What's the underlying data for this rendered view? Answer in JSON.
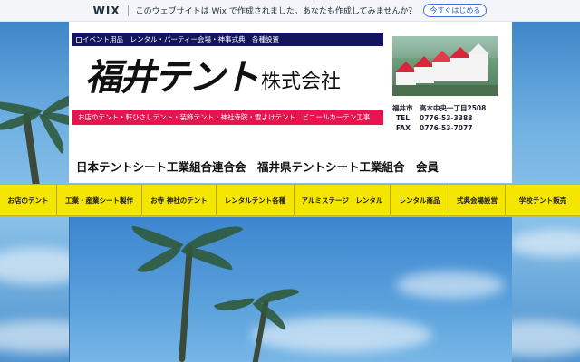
{
  "wix_bar": {
    "logo": "WIX",
    "message": "このウェブサイトは Wix で作成されました。あなたも作成してみませんか？",
    "cta": "今すぐはじめる"
  },
  "header": {
    "top_bar_text": "イベント用品　レンタル・パーティー会場・神事式典　各種設置",
    "logo_main": "福井テント",
    "logo_sub": "株式会社",
    "services_bar": "お店のテント・軒ひさしテント・装飾テント・神社寺院・雪よけテント　ビニールカーテン工事",
    "contact": {
      "address_label": "福井市",
      "address": "高木中央一丁目2508",
      "tel_label": "TEL",
      "tel": "0776-53-3388",
      "fax_label": "FAX",
      "fax": "0776-53-7077"
    },
    "union_text": "日本テントシート工業組合連合会　福井県テントシート工業組合　会員"
  },
  "nav": {
    "items": [
      {
        "label": "お店のテント"
      },
      {
        "label": "工業・産業シート製作"
      },
      {
        "label": "お寺 神社のテント"
      },
      {
        "label": "レンタルテント各種"
      },
      {
        "label": "アルミステージ　レンタル"
      },
      {
        "label": "レンタル商品"
      },
      {
        "label": "式典会場設営"
      },
      {
        "label": "学校テント販売"
      }
    ]
  },
  "colors": {
    "nav_bg": "#f5e600",
    "top_bar_bg": "#13135f",
    "services_bar_bg": "#e8144f",
    "sky": "#6aa3d6"
  }
}
